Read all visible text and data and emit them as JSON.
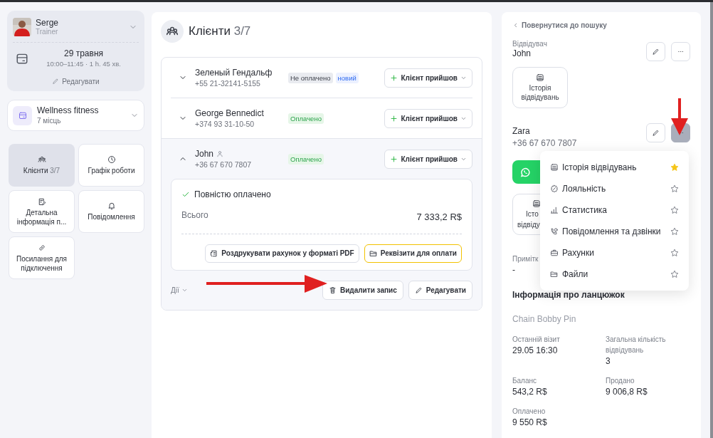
{
  "sidebar": {
    "profile": {
      "name": "Serge",
      "role": "Trainer",
      "date": "29 травня",
      "time": "10:00–11:45 · 1 h. 45 хв.",
      "edit": "Редагувати"
    },
    "location": {
      "name": "Wellness fitness",
      "places": "7 місць"
    },
    "tiles": [
      {
        "label": "Клієнти",
        "count": "3/7",
        "kind": "people",
        "selected": true
      },
      {
        "label": "Графік роботи",
        "kind": "clock",
        "selected": false
      },
      {
        "label": "Детальна інформація п...",
        "kind": "note",
        "selected": false
      },
      {
        "label": "Повідомлення",
        "kind": "bell",
        "selected": false
      },
      {
        "label": "Посилання для підключення",
        "kind": "link",
        "selected": false
      }
    ]
  },
  "main": {
    "title": "Клієнти",
    "count": "3/7",
    "clients": [
      {
        "name": "Зеленый Гендальф",
        "phone": "+55 21-32141-5155",
        "user_icon": false,
        "expanded": false,
        "badges": [
          {
            "text": "Не оплачено",
            "kind": "unpaid"
          },
          {
            "text": "новий",
            "kind": "new"
          }
        ],
        "action": "Клієнт прийшов"
      },
      {
        "name": "George Bennedict",
        "phone": "+374 93 31-10-50",
        "user_icon": false,
        "expanded": false,
        "badges": [
          {
            "text": "Оплачено",
            "kind": "paid"
          }
        ],
        "action": "Клієнт прийшов"
      },
      {
        "name": "John",
        "phone": "+36 67 670 7807",
        "user_icon": true,
        "expanded": true,
        "badges": [
          {
            "text": "Оплачено",
            "kind": "paid"
          }
        ],
        "action": "Клієнт прийшов",
        "details": {
          "status": "Повністю оплачено",
          "total_label": "Всього",
          "total": "7 333,2 R$",
          "buttons": [
            {
              "label": "Роздрукувати рахунок у форматі PDF",
              "kind": "print",
              "highlighted": false
            },
            {
              "label": "Реквізити для оплати",
              "kind": "folder",
              "highlighted": true
            }
          ]
        },
        "footer": {
          "actions": "Дії",
          "buttons": [
            {
              "label": "Видалити запис",
              "kind": "delete"
            },
            {
              "label": "Редагувати",
              "kind": "edit"
            }
          ]
        }
      }
    ]
  },
  "panel": {
    "back": "Повернутися до пошуку",
    "visitor": {
      "label": "Відвідувач",
      "name": "John",
      "history": "Історія відвідувань"
    },
    "contact": {
      "name": "Zara",
      "phone": "+36 67 670 7807",
      "menu_open": true,
      "history_lines": [
        "Істо",
        "відвіду"
      ]
    },
    "menu": [
      {
        "label": "Історія відвідувань",
        "kind": "history",
        "starred": true
      },
      {
        "label": "Лояльність",
        "kind": "badge",
        "starred": false
      },
      {
        "label": "Статистика",
        "kind": "bars",
        "starred": false
      },
      {
        "label": "Повідомлення та дзвінки",
        "kind": "phone",
        "starred": false
      },
      {
        "label": "Рахунки",
        "kind": "case",
        "starred": false
      },
      {
        "label": "Файли",
        "kind": "folder",
        "starred": false
      }
    ],
    "notes": {
      "label": "Примітк",
      "value": "-"
    },
    "chain": {
      "title": "Інформація про ланцюжок",
      "name": "Chain Bobby Pin",
      "stats": [
        {
          "label": "Останній візит",
          "value": "29.05 16:30"
        },
        {
          "label": "Загальна кількість відвідувань",
          "value": "3"
        },
        {
          "label": "Баланс",
          "value": "543,2 R$"
        },
        {
          "label": "Продано",
          "value": "9 006,8 R$"
        },
        {
          "label": "Оплачено",
          "value": "9 550 R$"
        }
      ]
    }
  }
}
